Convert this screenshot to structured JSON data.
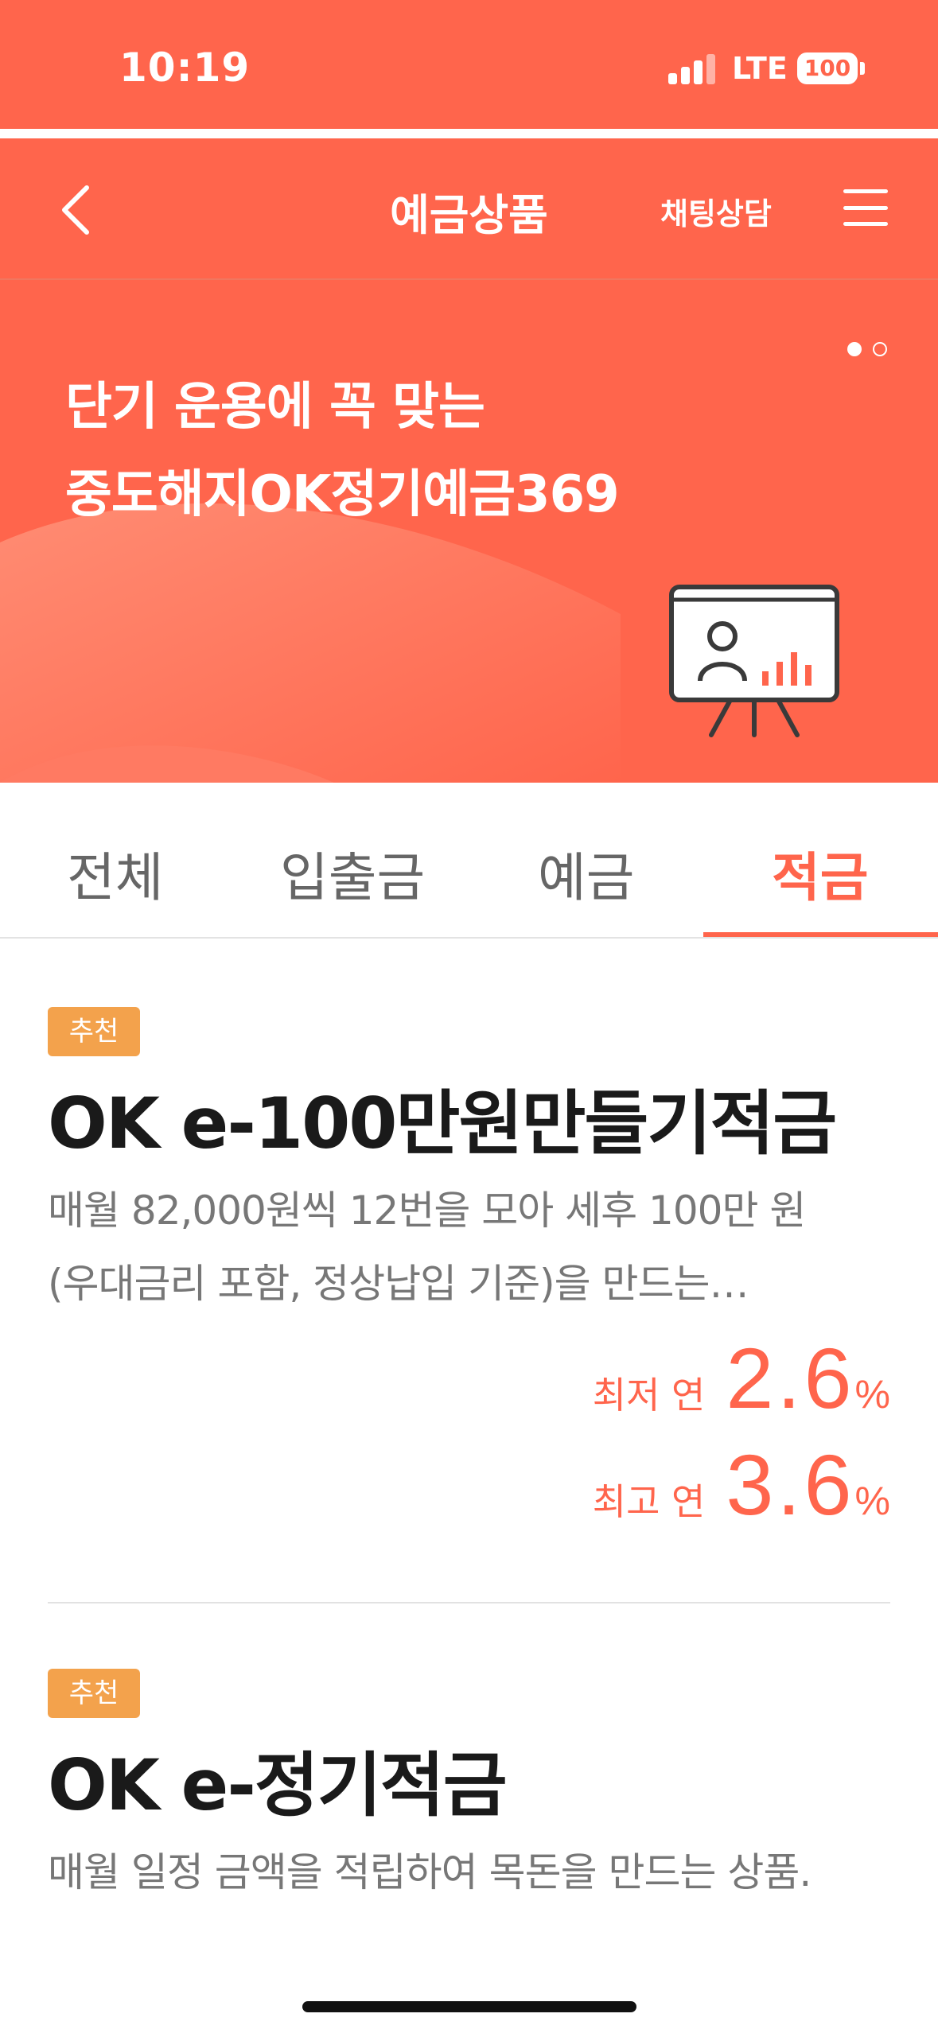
{
  "status": {
    "time": "10:19",
    "network": "LTE",
    "battery": "100"
  },
  "nav": {
    "title": "예금상품",
    "chat": "채팅상담"
  },
  "banner": {
    "line1": "단기 운용에 꼭 맞는",
    "line2": "중도해지OK정기예금369",
    "page_count": 2,
    "active_page": 1
  },
  "tabs": [
    {
      "label": "전체",
      "active": false
    },
    {
      "label": "입출금",
      "active": false
    },
    {
      "label": "예금",
      "active": false
    },
    {
      "label": "적금",
      "active": true
    }
  ],
  "products": [
    {
      "badge": "추천",
      "title": "OK e-100만원만들기적금",
      "desc_line1": "매월 82,000원씩 12번을 모아 세후 100만 원",
      "desc_line2": "(우대금리 포함, 정상납입 기준)을 만드는…",
      "rates": [
        {
          "label": "최저 연",
          "value": "2.6",
          "unit": "%"
        },
        {
          "label": "최고 연",
          "value": "3.6",
          "unit": "%"
        }
      ]
    },
    {
      "badge": "추천",
      "title": "OK e-정기적금",
      "desc_line1": "매월 일정 금액을 적립하여 목돈을 만드는 상품."
    }
  ],
  "colors": {
    "brand": "#FF654C",
    "badge": "#F3A24C",
    "text_dark": "#1A1A1A",
    "text_gray": "#777777"
  }
}
